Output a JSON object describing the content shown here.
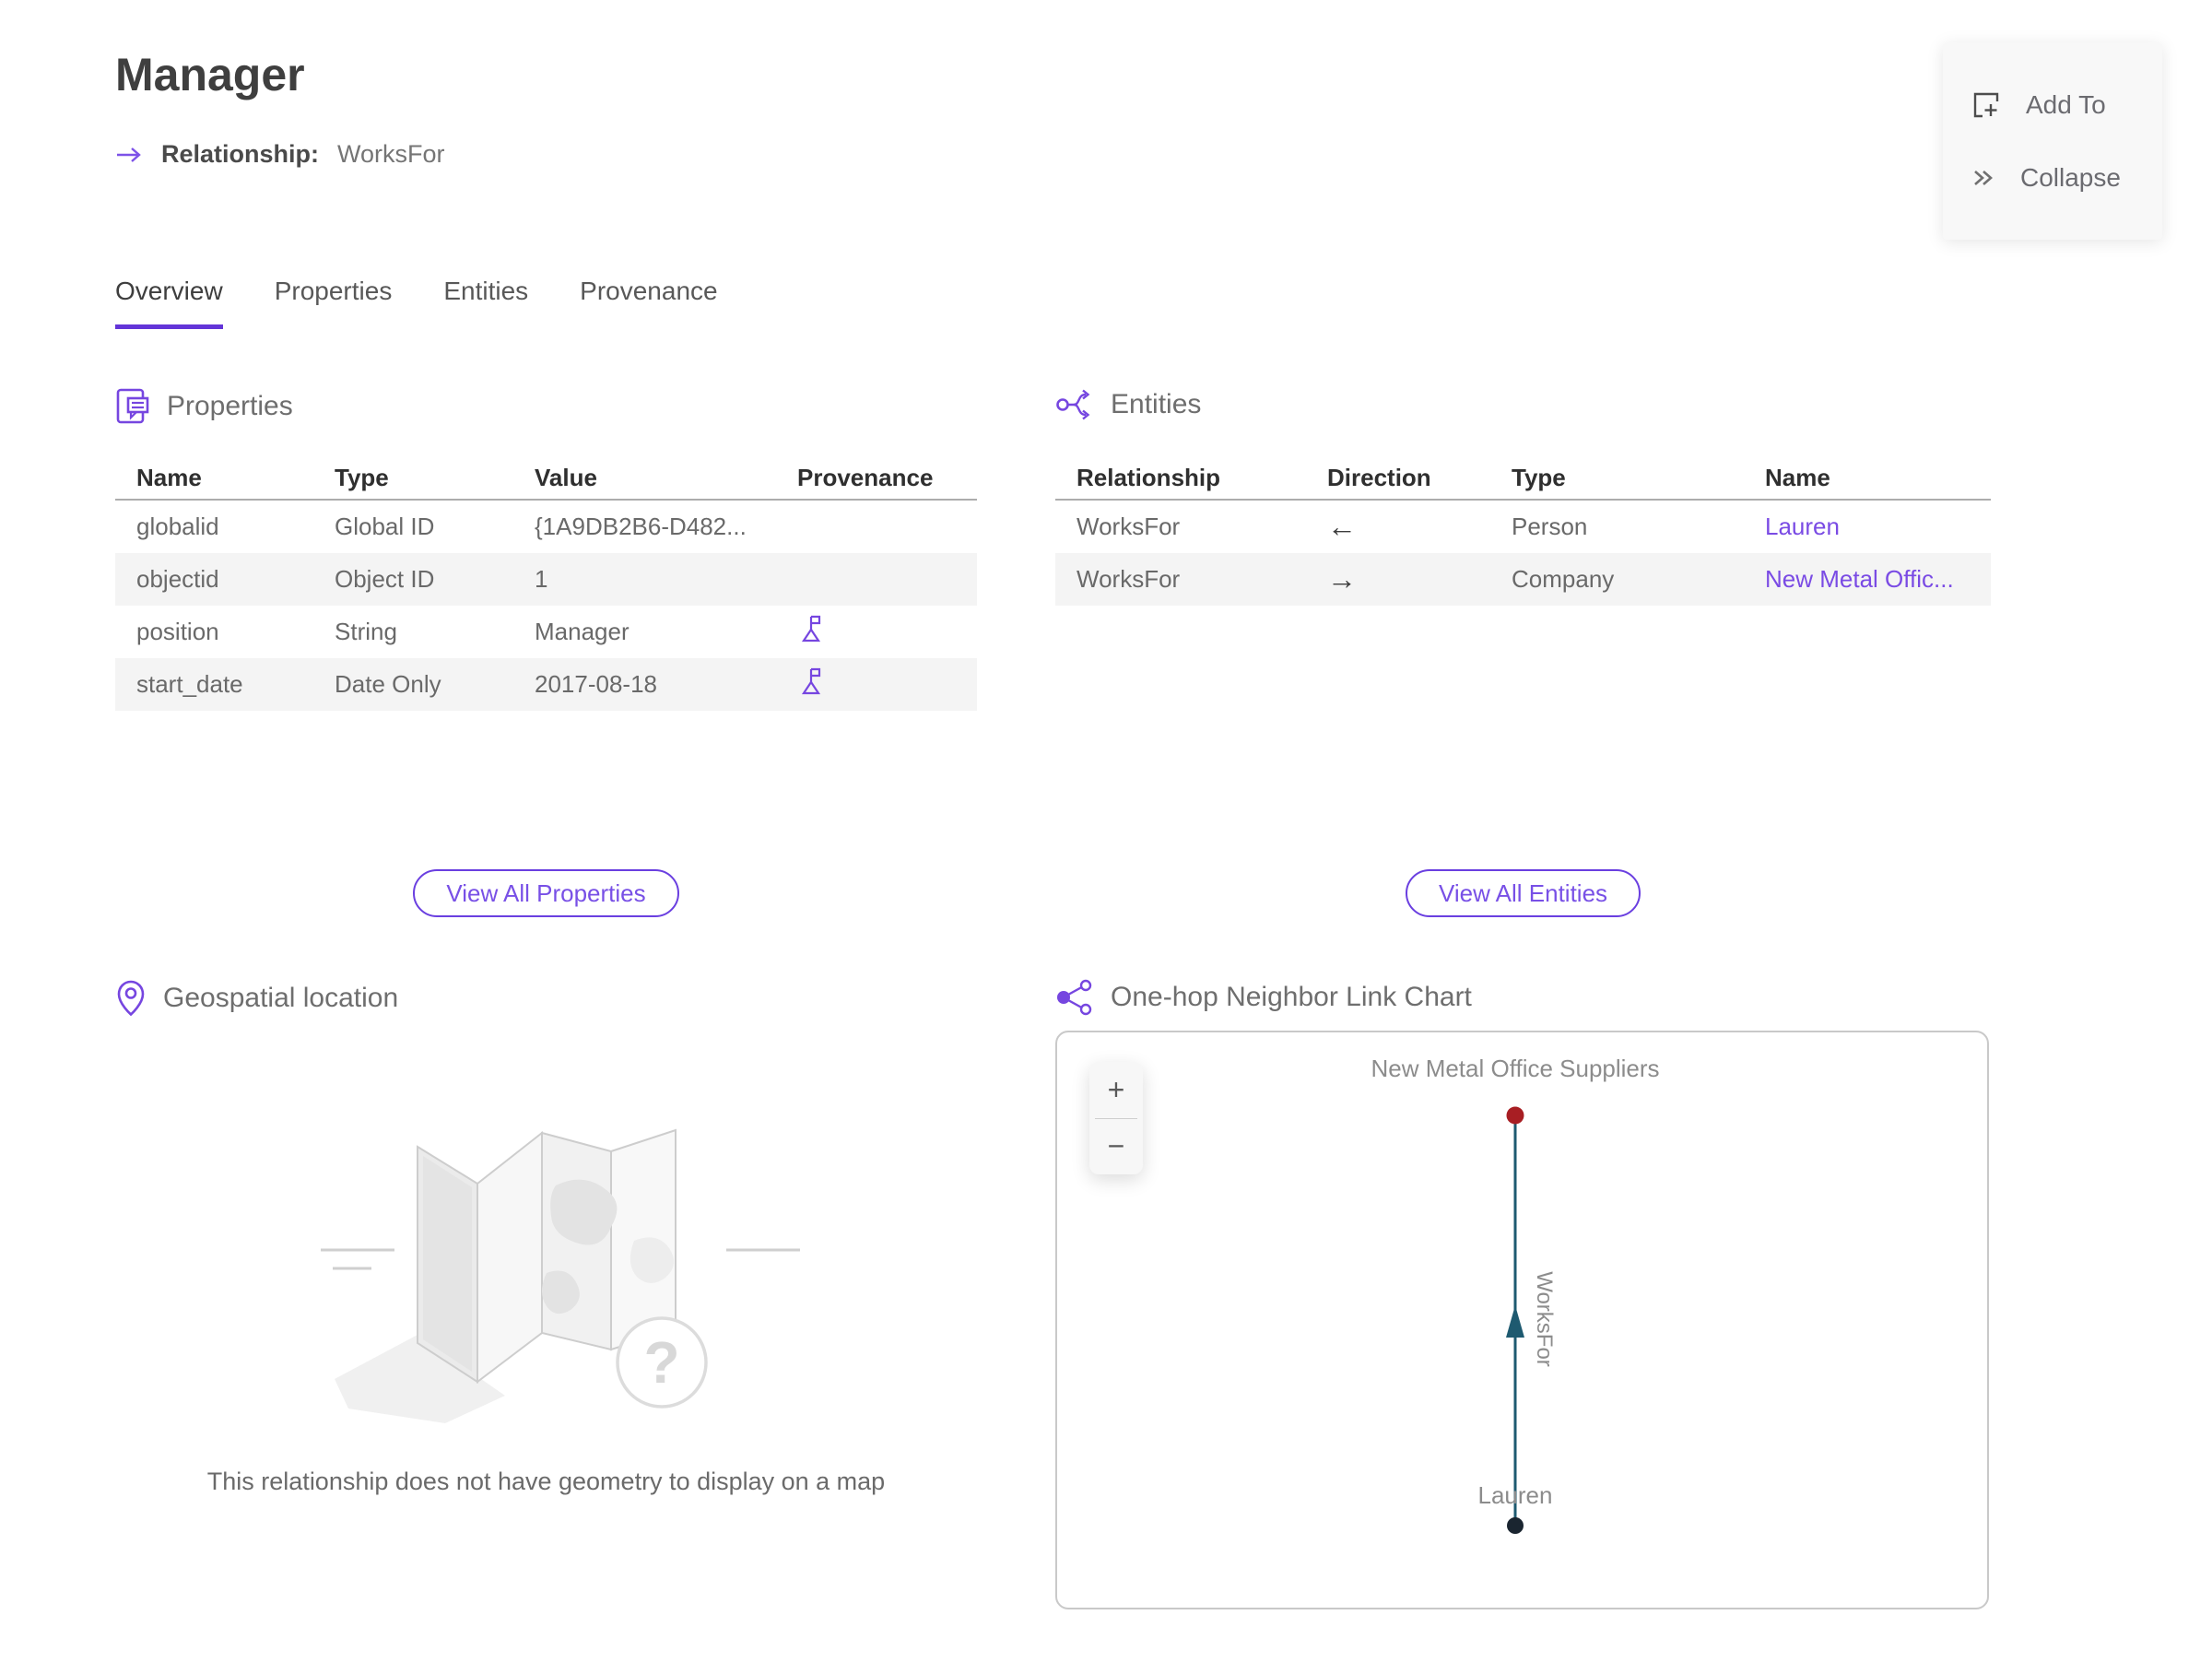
{
  "header": {
    "title": "Manager",
    "relationship_label": "Relationship:",
    "relationship_value": "WorksFor"
  },
  "actions_menu": {
    "add_to": "Add To",
    "collapse": "Collapse"
  },
  "tabs": [
    {
      "label": "Overview",
      "active": true
    },
    {
      "label": "Properties",
      "active": false
    },
    {
      "label": "Entities",
      "active": false
    },
    {
      "label": "Provenance",
      "active": false
    }
  ],
  "properties_section": {
    "title": "Properties",
    "columns": [
      "Name",
      "Type",
      "Value",
      "Provenance"
    ],
    "rows": [
      {
        "name": "globalid",
        "type": "Global ID",
        "value": "{1A9DB2B6-D482...",
        "has_provenance": false
      },
      {
        "name": "objectid",
        "type": "Object ID",
        "value": "1",
        "has_provenance": false
      },
      {
        "name": "position",
        "type": "String",
        "value": "Manager",
        "has_provenance": true
      },
      {
        "name": "start_date",
        "type": "Date Only",
        "value": "2017-08-18",
        "has_provenance": true
      }
    ],
    "view_all_label": "View All Properties"
  },
  "entities_section": {
    "title": "Entities",
    "columns": [
      "Relationship",
      "Direction",
      "Type",
      "Name"
    ],
    "rows": [
      {
        "relationship": "WorksFor",
        "direction": "←",
        "type": "Person",
        "name": "Lauren"
      },
      {
        "relationship": "WorksFor",
        "direction": "→",
        "type": "Company",
        "name": "New Metal Offic..."
      }
    ],
    "view_all_label": "View All Entities"
  },
  "geospatial_section": {
    "title": "Geospatial location",
    "empty_message": "This relationship does not have geometry to display on a map"
  },
  "link_chart_section": {
    "title": "One-hop Neighbor Link Chart",
    "zoom_in_label": "+",
    "zoom_out_label": "−",
    "top_node": {
      "label": "New Metal Office Suppliers",
      "color": "#a81e23"
    },
    "bottom_node": {
      "label": "Lauren",
      "color": "#1a2530"
    },
    "edge": {
      "label": "WorksFor",
      "color": "#1e5a70"
    }
  },
  "colors": {
    "accent_purple": "#7646e0",
    "link_purple": "#7a4be4",
    "tab_underline": "#6334d8",
    "edge_teal": "#1e5a70",
    "node_red": "#a81e23",
    "node_dark": "#1a2530",
    "row_stripe": "#f4f4f4"
  }
}
